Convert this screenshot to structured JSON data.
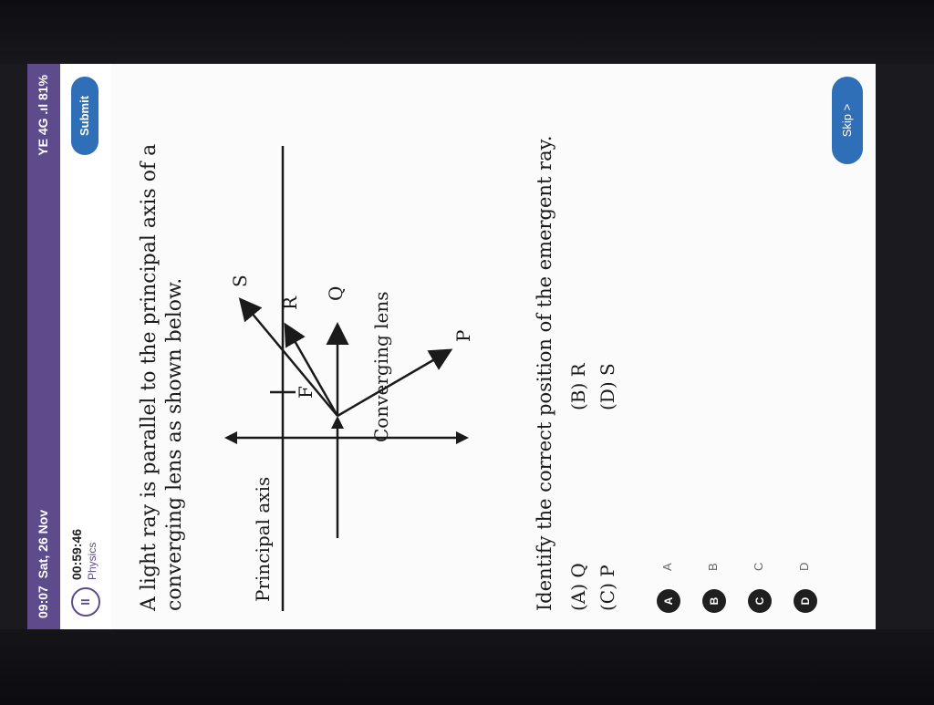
{
  "status": {
    "time": "09:07",
    "date": "Sat, 26 Nov",
    "system": "YE 4G .ıl 81%"
  },
  "header": {
    "pause_label": "II",
    "timer": "00:59:46",
    "subject": "Physics",
    "submit_label": "Submit"
  },
  "question": {
    "text": "A light ray is parallel to the principal axis of a converging lens as shown below.",
    "prompt": "Identify the correct position of the emergent ray.",
    "inline_options": [
      "(A) Q",
      "(B) R",
      "(C) P",
      "(D) S"
    ]
  },
  "diagram": {
    "labels": {
      "axis": "Principal axis",
      "lens": "Converging lens",
      "focus": "F",
      "P": "P",
      "Q": "Q",
      "R": "R",
      "S": "S"
    }
  },
  "choices": [
    {
      "badge": "A",
      "label": "A"
    },
    {
      "badge": "B",
      "label": "B"
    },
    {
      "badge": "C",
      "label": "C"
    },
    {
      "badge": "D",
      "label": "D"
    }
  ],
  "footer": {
    "skip_label": "Skip >"
  },
  "colors": {
    "status_bar": "#5d4b8c",
    "accent_button": "#2f6fb8"
  }
}
